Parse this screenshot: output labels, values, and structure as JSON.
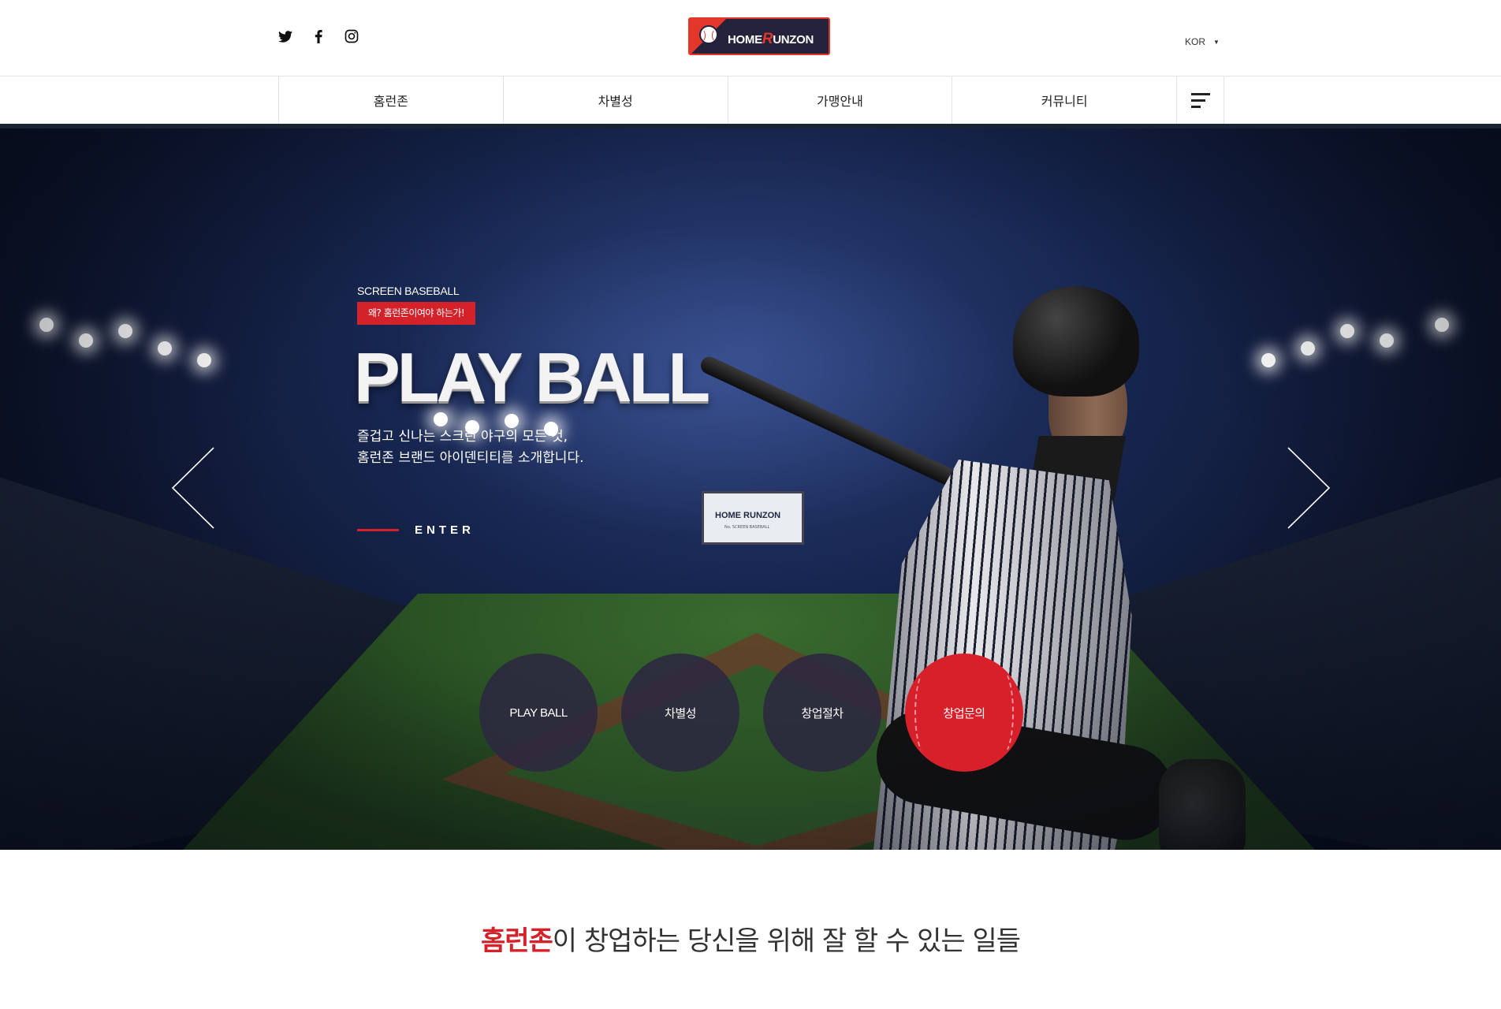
{
  "header": {
    "social": [
      {
        "name": "twitter-icon"
      },
      {
        "name": "facebook-icon"
      },
      {
        "name": "instagram-icon"
      }
    ],
    "logo": {
      "home": "HOME",
      "r": "R",
      "unzon": "UNZON"
    },
    "lang": {
      "label": "KOR",
      "caret": "▼"
    }
  },
  "nav": {
    "items": [
      "홈런존",
      "차별성",
      "가맹안내",
      "커뮤니티"
    ]
  },
  "hero": {
    "subtitle": "SCREEN BASEBALL",
    "badge": "왜? 홈런존이여야 하는가!",
    "title": "PLAY BALL",
    "desc_lines": [
      "즐겁고 신나는 스크린 야구의 모든 것,",
      "홈런존 브랜드 아이덴티티를 소개합니다."
    ],
    "enter": "ENTER",
    "scoreboard": {
      "text": "HOME RUNZON",
      "sub": "No. SCREEN BASEBALL"
    },
    "circles": [
      "PLAY BALL",
      "차별성",
      "창업절차",
      "창업문의"
    ],
    "colors": {
      "accent": "#d4222a",
      "circle": "#2c2840",
      "navy": "#1a2334"
    }
  },
  "section": {
    "title_highlight": "홈런존",
    "title_rest": "이 창업하는 당신을 위해 잘 할 수 있는 일들"
  }
}
